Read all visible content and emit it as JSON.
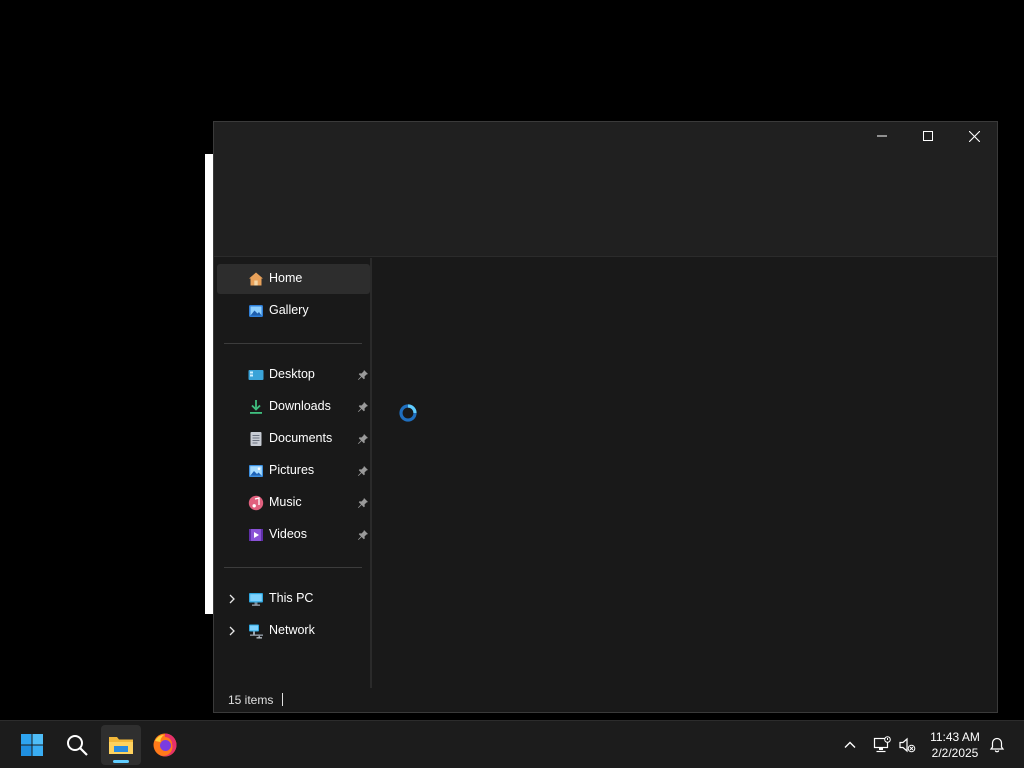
{
  "window": {
    "controls": {
      "minimize_icon": "minimize-icon",
      "maximize_icon": "maximize-icon",
      "close_icon": "close-icon"
    }
  },
  "nav_pane": {
    "items": [
      {
        "label": "Home",
        "icon": "home-icon",
        "selected": true
      },
      {
        "label": "Gallery",
        "icon": "gallery-icon"
      },
      {
        "label": "Desktop",
        "icon": "desktop-icon",
        "pinned": true
      },
      {
        "label": "Downloads",
        "icon": "downloads-icon",
        "pinned": true
      },
      {
        "label": "Documents",
        "icon": "documents-icon",
        "pinned": true
      },
      {
        "label": "Pictures",
        "icon": "pictures-icon",
        "pinned": true
      },
      {
        "label": "Music",
        "icon": "music-icon",
        "pinned": true
      },
      {
        "label": "Videos",
        "icon": "videos-icon",
        "pinned": true
      },
      {
        "label": "This PC",
        "icon": "this-pc-icon",
        "expandable": true
      },
      {
        "label": "Network",
        "icon": "network-icon",
        "expandable": true
      }
    ]
  },
  "content": {
    "loading_icon": "loading-spinner-icon"
  },
  "status_bar": {
    "item_count": "15 items"
  },
  "taskbar": {
    "apps": [
      "start-icon",
      "search-icon",
      "file-explorer-icon",
      "firefox-icon"
    ],
    "tray": [
      "chevron-up-icon",
      "network-status-icon",
      "volume-muted-icon",
      "notification-bell-icon"
    ],
    "time": "11:43 AM",
    "date": "2/2/2025"
  },
  "colors": {
    "accent": "#60cdff",
    "window_bg": "#191919",
    "titlebar_bg": "#202020",
    "taskbar_bg": "#1c1c1c"
  }
}
